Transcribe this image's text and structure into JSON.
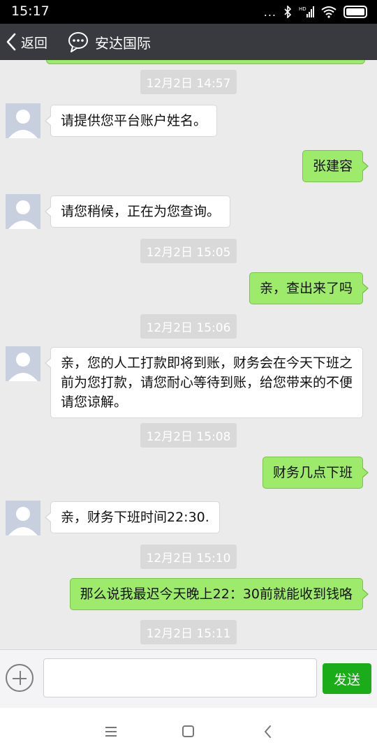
{
  "status_bar": {
    "time": "15:17",
    "dots": "...",
    "icons": [
      "bluetooth-icon",
      "signal-hd-icon",
      "wifi-icon",
      "battery-icon"
    ]
  },
  "header": {
    "back_label": "返回",
    "title": "安达国际",
    "bg_color": "#393a3f"
  },
  "timestamps": [
    "12月2日 14:57",
    "12月2日 15:05",
    "12月2日 15:06",
    "12月2日 15:08",
    "12月2日 15:10",
    "12月2日 15:11"
  ],
  "messages": [
    {
      "side": "left",
      "text": "请提供您平台账户姓名。"
    },
    {
      "side": "right",
      "text": "张建容"
    },
    {
      "side": "left",
      "text": "请您稍候，正在为您查询。"
    },
    {
      "side": "right",
      "text": "亲，查出来了吗"
    },
    {
      "side": "left",
      "text": "亲，您的人工打款即将到账，财务会在今天下班之前为您打款，请您耐心等待到账，给您带来的不便请您谅解。"
    },
    {
      "side": "right",
      "text": "财务几点下班"
    },
    {
      "side": "left",
      "text": "亲，财务下班时间22:30."
    },
    {
      "side": "right",
      "text": "那么说我最迟今天晚上22：30前就能收到钱咯"
    }
  ],
  "input": {
    "value": "",
    "send_label": "发送",
    "send_color": "#1aad19"
  },
  "colors": {
    "chat_bg": "#ebebeb",
    "right_bubble": "#9eea6a",
    "left_bubble": "#ffffff",
    "timestamp_bg": "#d9d9d9"
  }
}
